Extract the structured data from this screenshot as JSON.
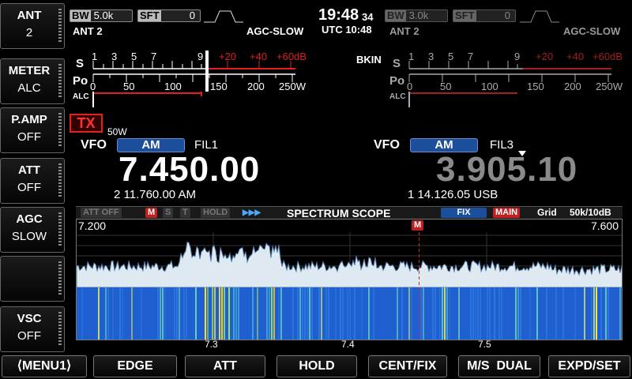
{
  "left_keys": [
    {
      "title": "ANT",
      "value": "2"
    },
    {
      "title": "METER",
      "value": "ALC"
    },
    {
      "title": "P.AMP",
      "value": "OFF"
    },
    {
      "title": "ATT",
      "value": "OFF"
    },
    {
      "title": "AGC",
      "value": "SLOW"
    },
    {
      "title": "",
      "value": ""
    },
    {
      "title": "VSC",
      "value": "OFF"
    }
  ],
  "bottom_keys": [
    "⟨MENU1⟩",
    "EDGE",
    "ATT",
    "HOLD",
    "CENT/FIX",
    "M/S  DUAL",
    "EXPD/SET"
  ],
  "clock": {
    "time": "19:48",
    "seconds": "34",
    "utc": "UTC 10:48"
  },
  "main_rx": {
    "bw_key": "BW",
    "bw": "5.0k",
    "sft_key": "SFT",
    "sft": "0",
    "ant": "ANT 2",
    "agc": "AGC-SLOW",
    "meter_s_label": "S",
    "meter_po_label": "Po",
    "meter_alc_label": "ALC",
    "s_scale": [
      "1",
      "3",
      "5",
      "7",
      "9",
      "+20",
      "+40",
      "+60dB"
    ],
    "po_scale": [
      "0",
      "50",
      "100",
      "150",
      "200",
      "250W"
    ],
    "tx_badge": "TX",
    "power": "50W",
    "vfo_label": "VFO",
    "mode": "AM",
    "filter": "FIL1",
    "frequency": "7.450.00",
    "sub_info": "2  11.760.00  AM"
  },
  "sub_rx": {
    "bw_key": "BW",
    "bw": "3.0k",
    "sft_key": "SFT",
    "sft": "0",
    "ant": "ANT 2",
    "agc": "AGC-SLOW",
    "bkin": "BKIN",
    "meter_s_label": "S",
    "meter_po_label": "Po",
    "meter_alc_label": "ALC",
    "s_scale": [
      "1",
      "3",
      "5",
      "7",
      "9",
      "+20",
      "+40",
      "+60dB"
    ],
    "po_scale": [
      "0",
      "50",
      "100",
      "150",
      "200",
      "250W"
    ],
    "vfo_label": "VFO",
    "mode": "AM",
    "filter": "FIL3",
    "frequency": "3.905.10",
    "sub_info": "1  14.126.05  USB"
  },
  "scope": {
    "att_off": "ATT OFF",
    "m": "M",
    "s": "S",
    "t": "T",
    "hold": "HOLD",
    "arrows": "▶▶▶",
    "title": "SPECTRUM  SCOPE",
    "fix": "FIX",
    "main": "MAIN",
    "grid": "Grid",
    "span": "50k/10dB",
    "left_freq": "7.200",
    "right_freq": "7.600",
    "marker": "M",
    "freq_ticks": [
      "7.3",
      "7.4",
      "7.5"
    ],
    "marker_fraction": 0.625
  },
  "colors": {
    "accent_blue": "#1d4e9c",
    "tx_red": "#d22",
    "scale_red": "#e02020",
    "scope_fill": "#dfe9f2",
    "waterfall_base": "#1f5fd0"
  }
}
